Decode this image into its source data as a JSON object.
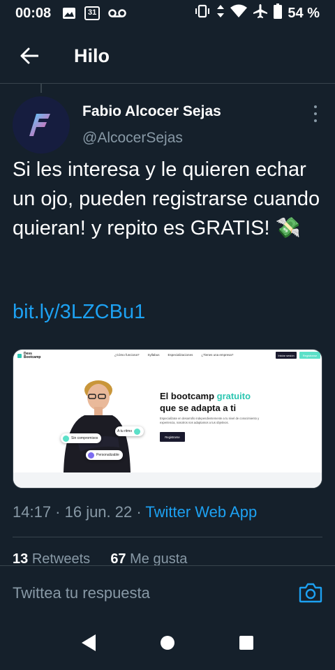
{
  "status_bar": {
    "time": "00:08",
    "calendar_day": "31",
    "battery": "54 %"
  },
  "header": {
    "title": "Hilo"
  },
  "tweet": {
    "author_name": "Fabio Alcocer Sejas",
    "author_handle": "@AlcocerSejas",
    "text": "Si les interesa y le quieren echar un ojo, pueden registrarse cuando quieran! y repito es GRATIS! 💸",
    "link": "bit.ly/3LZCBu1",
    "timestamp": "14:17 · 16 jun. 22 · ",
    "source": "Twitter Web App",
    "retweets_count": "13",
    "retweets_label": "Retweets",
    "likes_count": "67",
    "likes_label": "Me gusta"
  },
  "card": {
    "logo_line1": "Devs",
    "logo_line2": "Bootcamp",
    "menu": [
      "¿Cómo funciona?",
      "Syllabus",
      "Especializaciones",
      "¿Tienes una empresa?"
    ],
    "login_label": "Iniciar sesión",
    "signup_label": "Registrarse",
    "headline_prefix": "El bootcamp ",
    "headline_accent": "gratuito",
    "headline_line2": "que se adapta a ti",
    "subtext": "Especialízate en desarrollo independientemente a tu nivel de conocimiento y experiencia, nosotros nos adaptamos a tus objetivos.",
    "cta_label": "Registrarse",
    "pill_1": "A tu ritmo",
    "pill_2": "Sin compromisos",
    "pill_3": "Personalizable"
  },
  "reply": {
    "placeholder": "Twittea tu respuesta"
  },
  "colors": {
    "background": "#15202b",
    "accent": "#1da1f2",
    "muted": "#8899a6",
    "divider": "#38444d"
  }
}
